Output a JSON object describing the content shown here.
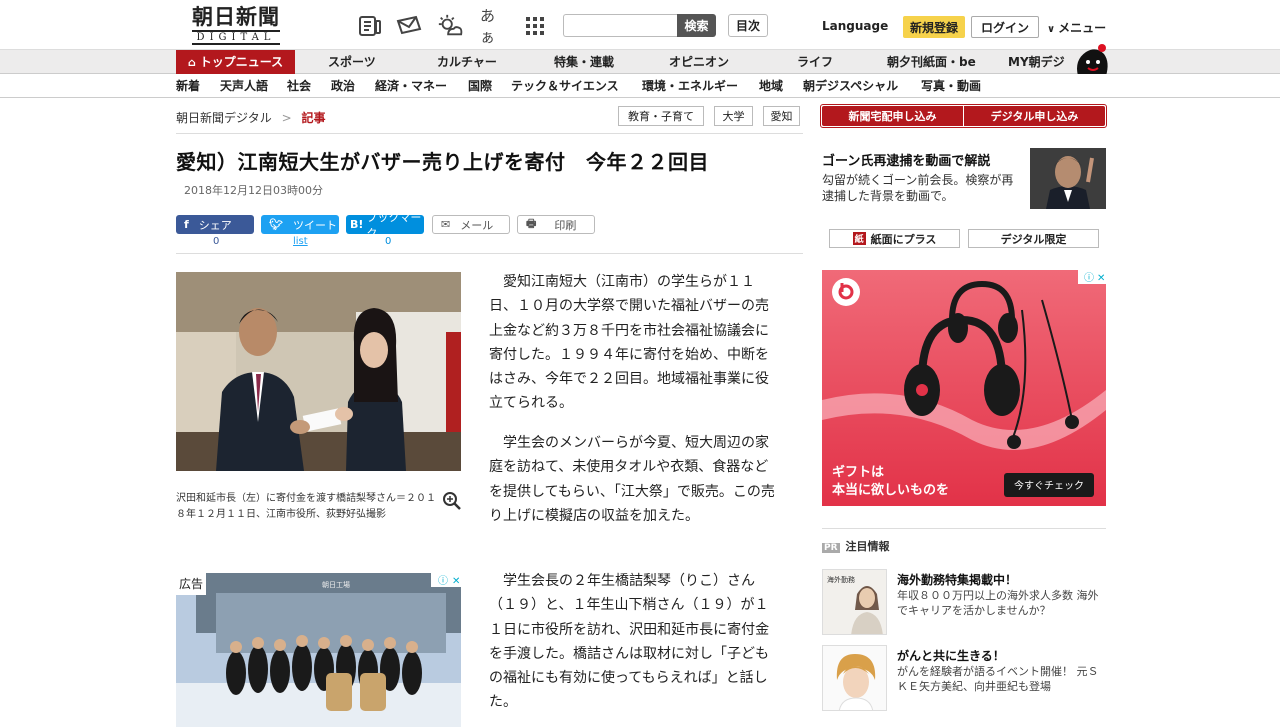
{
  "header": {
    "logo_main": "朝日新聞",
    "logo_sub": "DIGITAL",
    "icons": [
      "newspaper-icon",
      "mail-icon",
      "weather-icon",
      "font-size-icon",
      "grid-menu-icon"
    ],
    "font_icon_text": "あぁ",
    "search_placeholder": "",
    "search_button": "検索",
    "index_button": "目次",
    "language": "Language",
    "register": "新規登録",
    "login": "ログイン",
    "menu": "メニュー"
  },
  "nav_primary": [
    "トップニュース",
    "スポーツ",
    "カルチャー",
    "特集・連載",
    "オピニオン",
    "ライフ",
    "朝夕刊紙面・be",
    "MY朝デジ"
  ],
  "nav_secondary": [
    "新着",
    "天声人語",
    "社会",
    "政治",
    "経済・マネー",
    "国際",
    "テック＆サイエンス",
    "環境・エネルギー",
    "地域",
    "朝デジスペシャル",
    "写真・動画"
  ],
  "breadcrumb": {
    "home": "朝日新聞デジタル",
    "sep": ">",
    "current": "記事"
  },
  "tags": [
    "教育・子育て",
    "大学",
    "愛知"
  ],
  "article": {
    "title": "愛知）江南短大生がバザー売り上げを寄付　今年２２回目",
    "date": "2018年12月12日03時00分",
    "share": {
      "facebook_label": "シェア",
      "facebook_count": "0",
      "twitter_label": "ツイート",
      "twitter_count": "list",
      "hatena_label": "ブックマーク",
      "hatena_count": "0",
      "mail_label": "メール",
      "print_label": "印刷"
    },
    "photo_caption": "沢田和延市長（左）に寄付金を渡す橋詰梨琴さん＝２０１８年１２月１１日、江南市役所、荻野好弘撮影",
    "paragraphs": [
      "愛知江南短大（江南市）の学生らが１１日、１０月の大学祭で開いた福祉バザーの売上金など約３万８千円を市社会福祉協議会に寄付した。１９９４年に寄付を始め、中断をはさみ、今年で２２回目。地域福祉事業に役立てられる。",
      "学生会のメンバーらが今夏、短大周辺の家庭を訪ねて、未使用タオルや衣類、食器などを提供してもらい、「江大祭」で販売。この売り上げに模擬店の収益を加えた。",
      "学生会長の２年生橋詰梨琴（りこ）さん（１９）と、１年生山下梢さん（１９）が１１日に市役所を訪れ、沢田和延市長に寄付金を手渡した。橋詰さんは取材に対し「子どもの福祉にも有効に使ってもらえれば」と話した。"
    ],
    "ad_label": "広告",
    "ad_sign": "朝日工場"
  },
  "sidebar": {
    "subscribe_paper": "新聞宅配申し込み",
    "subscribe_digital": "デジタル申し込み",
    "promo_title": "ゴーン氏再逮捕を動画で解説",
    "promo_text": "勾留が続くゴーン前会長。検察が再逮捕した背景を動画で。",
    "btn_plus": "紙面にプラス",
    "btn_digital_only": "デジタル限定",
    "ad_text_line1": "ギフトは",
    "ad_text_line2": "本当に欲しいものを",
    "ad_cta": "今すぐチェック",
    "pr_label": "注目情報",
    "pr_badge": "PR",
    "pr_items": [
      {
        "title": "海外勤務特集掲載中！",
        "text": "年収８００万円以上の海外求人多数 海外でキャリアを活かしませんか？",
        "thumb_text": "海外勤務"
      },
      {
        "title": "がんと共に生きる！",
        "text": "がんを経験者が語るイベント開催！ 元ＳＫＥ矢方美紀、向井亜紀も登場"
      }
    ]
  },
  "colors": {
    "brand_red": "#b3181d",
    "yellow": "#f6d24b",
    "facebook": "#3b5998",
    "twitter": "#1da1f2",
    "hatena": "#008fde"
  }
}
